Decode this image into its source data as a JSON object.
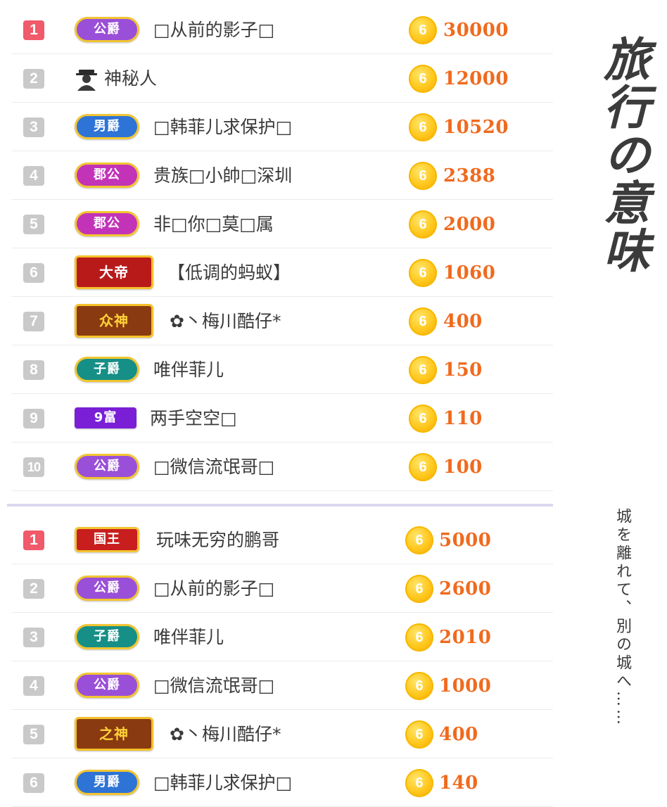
{
  "colors": {
    "rank_first": "#f05a6a",
    "rank_default": "#c9c9c9",
    "amount": "#f06a1e",
    "coin": "#ffc61a",
    "badge_border": "#f2c531"
  },
  "board_a": {
    "rows": [
      {
        "rank": "1",
        "badge": "公爵",
        "name": "□从前的影子□",
        "coin": "6",
        "amount": "30000"
      },
      {
        "rank": "2",
        "badge": "",
        "avatar": "incognito-avatar-icon",
        "name": "神秘人",
        "coin": "6",
        "amount": "12000"
      },
      {
        "rank": "3",
        "badge": "男爵",
        "name": "□韩菲儿求保护□",
        "coin": "6",
        "amount": "10520"
      },
      {
        "rank": "4",
        "badge": "郡公",
        "name": "贵族□小帥□深圳",
        "coin": "6",
        "amount": "2388"
      },
      {
        "rank": "5",
        "badge": "郡公",
        "name": "非□你□莫□属",
        "coin": "6",
        "amount": "2000"
      },
      {
        "rank": "6",
        "badge": "大帝",
        "name": "【低调的蚂蚁】",
        "coin": "6",
        "amount": "1060"
      },
      {
        "rank": "7",
        "badge": "众神",
        "name": "✿丶梅川酷仔*",
        "coin": "6",
        "amount": "400"
      },
      {
        "rank": "8",
        "badge": "子爵",
        "name": "唯伴菲儿",
        "coin": "6",
        "amount": "150"
      },
      {
        "rank": "9",
        "badge": "9富",
        "name": "两手空空□",
        "coin": "6",
        "amount": "110"
      },
      {
        "rank": "10",
        "badge": "公爵",
        "name": "□微信流氓哥□",
        "coin": "6",
        "amount": "100"
      }
    ]
  },
  "board_b": {
    "rows": [
      {
        "rank": "1",
        "badge": "国王",
        "name": "玩味无穷的鹏哥",
        "coin": "6",
        "amount": "5000"
      },
      {
        "rank": "2",
        "badge": "公爵",
        "name": "□从前的影子□",
        "coin": "6",
        "amount": "2600"
      },
      {
        "rank": "3",
        "badge": "子爵",
        "name": "唯伴菲儿",
        "coin": "6",
        "amount": "2010"
      },
      {
        "rank": "4",
        "badge": "公爵",
        "name": "□微信流氓哥□",
        "coin": "6",
        "amount": "1000"
      },
      {
        "rank": "5",
        "badge": "之神",
        "name": "✿丶梅川酷仔*",
        "coin": "6",
        "amount": "400"
      },
      {
        "rank": "6",
        "badge": "男爵",
        "name": "□韩菲儿求保护□",
        "coin": "6",
        "amount": "140"
      }
    ]
  },
  "side_title": "旅行の意味",
  "side_subtitle": "城を離れて、別の城へ……"
}
